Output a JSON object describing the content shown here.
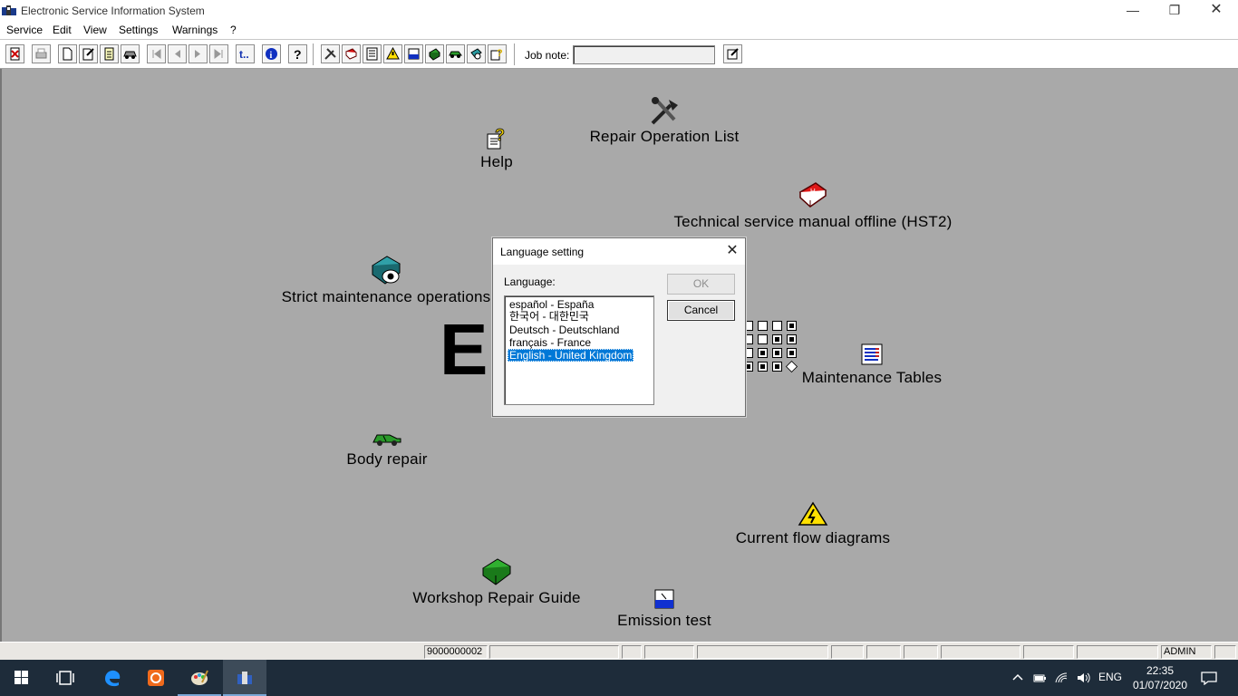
{
  "window": {
    "title": "Electronic Service Information System"
  },
  "menu": [
    "Service",
    "Edit",
    "View",
    "Settings",
    "Warnings",
    "?"
  ],
  "toolbar": {
    "job_note_label": "Job note:",
    "job_note_value": ""
  },
  "workspace": {
    "logo_text": "EI",
    "items": {
      "repair_operation_list": "Repair Operation List",
      "help": "Help",
      "technical_service_manual": "Technical service manual offline (HST2)",
      "strict_maintenance": "Strict maintenance operations",
      "maintenance_tables": "Maintenance Tables",
      "body_repair": "Body repair",
      "current_flow_diagrams": "Current flow diagrams",
      "workshop_repair_guide": "Workshop Repair Guide",
      "emission_test": "Emission test"
    }
  },
  "dialog": {
    "title": "Language setting",
    "language_label": "Language:",
    "languages": [
      "español - España",
      "한국어 - 대한민국",
      "Deutsch - Deutschland",
      "français - France",
      "English - United Kingdom"
    ],
    "selected": "English - United Kingdom",
    "ok_label": "OK",
    "cancel_label": "Cancel"
  },
  "statusbar": {
    "number": "9000000002",
    "user": "ADMIN"
  },
  "taskbar": {
    "language": "ENG",
    "time": "22:35",
    "date": "01/07/2020"
  }
}
